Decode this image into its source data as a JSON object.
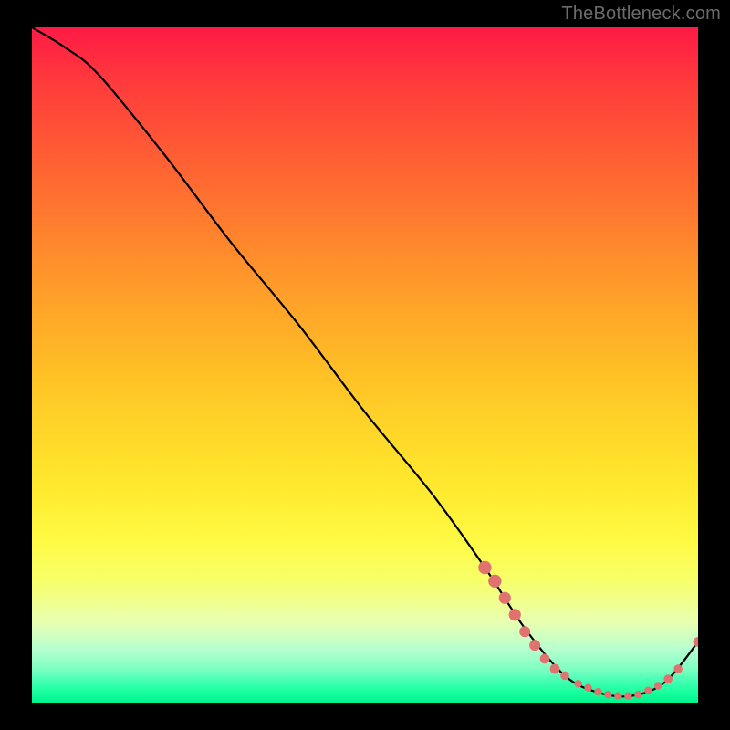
{
  "watermark": "TheBottleneck.com",
  "chart_data": {
    "type": "line",
    "title": "",
    "xlabel": "",
    "ylabel": "",
    "xlim": [
      0,
      100
    ],
    "ylim": [
      0,
      100
    ],
    "series": [
      {
        "name": "curve",
        "x": [
          0,
          5,
          10,
          20,
          30,
          40,
          50,
          60,
          68,
          74,
          80,
          85,
          90,
          95,
          100
        ],
        "y": [
          100,
          97,
          93,
          81,
          68,
          56,
          43,
          31,
          20,
          11,
          4,
          1.5,
          1,
          3,
          9
        ]
      }
    ],
    "markers": [
      {
        "x": 68,
        "y": 20,
        "r": 1.2
      },
      {
        "x": 69.5,
        "y": 18,
        "r": 1.2
      },
      {
        "x": 71,
        "y": 15.5,
        "r": 1.1
      },
      {
        "x": 72.5,
        "y": 13,
        "r": 1.1
      },
      {
        "x": 74,
        "y": 10.5,
        "r": 1.0
      },
      {
        "x": 75.5,
        "y": 8.5,
        "r": 1.0
      },
      {
        "x": 77,
        "y": 6.5,
        "r": 0.9
      },
      {
        "x": 78.5,
        "y": 5,
        "r": 0.9
      },
      {
        "x": 80,
        "y": 4,
        "r": 0.8
      },
      {
        "x": 82,
        "y": 2.8,
        "r": 0.7
      },
      {
        "x": 83.5,
        "y": 2.2,
        "r": 0.7
      },
      {
        "x": 85,
        "y": 1.6,
        "r": 0.7
      },
      {
        "x": 86.5,
        "y": 1.2,
        "r": 0.7
      },
      {
        "x": 88,
        "y": 1.0,
        "r": 0.7
      },
      {
        "x": 89.5,
        "y": 1.0,
        "r": 0.7
      },
      {
        "x": 91,
        "y": 1.2,
        "r": 0.7
      },
      {
        "x": 92.5,
        "y": 1.8,
        "r": 0.7
      },
      {
        "x": 94,
        "y": 2.5,
        "r": 0.7
      },
      {
        "x": 95.5,
        "y": 3.5,
        "r": 0.8
      },
      {
        "x": 97,
        "y": 5,
        "r": 0.8
      },
      {
        "x": 100,
        "y": 9,
        "r": 0.9
      }
    ],
    "marker_color": "#e0736f",
    "curve_color": "#000000"
  }
}
